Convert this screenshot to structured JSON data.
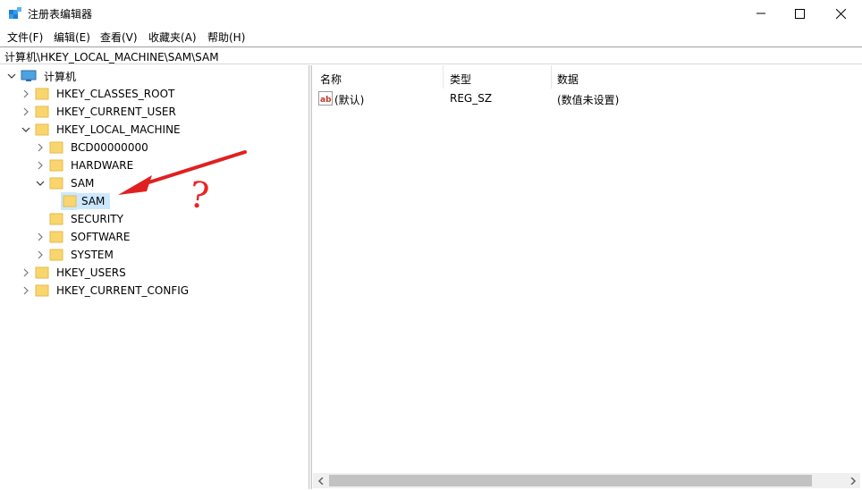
{
  "window": {
    "title": "注册表编辑器",
    "app_icon": "registry-editor-icon"
  },
  "menu": [
    "文件(F)",
    "编辑(E)",
    "查看(V)",
    "收藏夹(A)",
    "帮助(H)"
  ],
  "address": "计算机\\HKEY_LOCAL_MACHINE\\SAM\\SAM",
  "tree": {
    "root": "计算机",
    "nodes": [
      {
        "label": "HKEY_CLASSES_ROOT",
        "state": "collapsed"
      },
      {
        "label": "HKEY_CURRENT_USER",
        "state": "collapsed"
      },
      {
        "label": "HKEY_LOCAL_MACHINE",
        "state": "expanded"
      },
      {
        "label": "BCD00000000",
        "state": "collapsed"
      },
      {
        "label": "HARDWARE",
        "state": "collapsed"
      },
      {
        "label": "SAM",
        "state": "expanded"
      },
      {
        "label": "SAM",
        "state": "selected"
      },
      {
        "label": "SECURITY",
        "state": "leaf"
      },
      {
        "label": "SOFTWARE",
        "state": "collapsed"
      },
      {
        "label": "SYSTEM",
        "state": "collapsed"
      },
      {
        "label": "HKEY_USERS",
        "state": "collapsed"
      },
      {
        "label": "HKEY_CURRENT_CONFIG",
        "state": "collapsed"
      }
    ]
  },
  "list": {
    "columns": [
      "名称",
      "类型",
      "数据"
    ],
    "rows": [
      {
        "name": "(默认)",
        "type": "REG_SZ",
        "data": "(数值未设置)",
        "icon": "string-value-icon"
      }
    ]
  },
  "annotation": {
    "symbol": "?",
    "color": "#e02020"
  }
}
